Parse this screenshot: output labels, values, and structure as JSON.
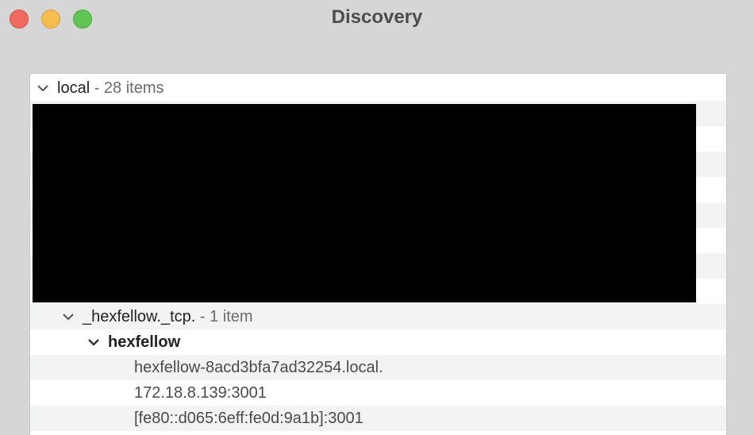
{
  "window": {
    "title": "Discovery"
  },
  "tree": {
    "root": {
      "label": "local",
      "count": " - 28 items"
    },
    "service": {
      "label": "_hexfellow._tcp.",
      "count": " - 1 item"
    },
    "host": {
      "label": "hexfellow",
      "details": [
        "hexfellow-8acd3bfa7ad32254.local.",
        "172.18.8.139:3001",
        "[fe80::d065:6eff:fe0d:9a1b]:3001"
      ]
    }
  },
  "icons": {
    "expand": "chevron-down-icon"
  },
  "colors": {
    "close": "#ee6a5f",
    "minimize": "#f5bd4f",
    "zoom": "#61c554",
    "row_alt": "#f2f4f3",
    "redaction": "#000000"
  }
}
